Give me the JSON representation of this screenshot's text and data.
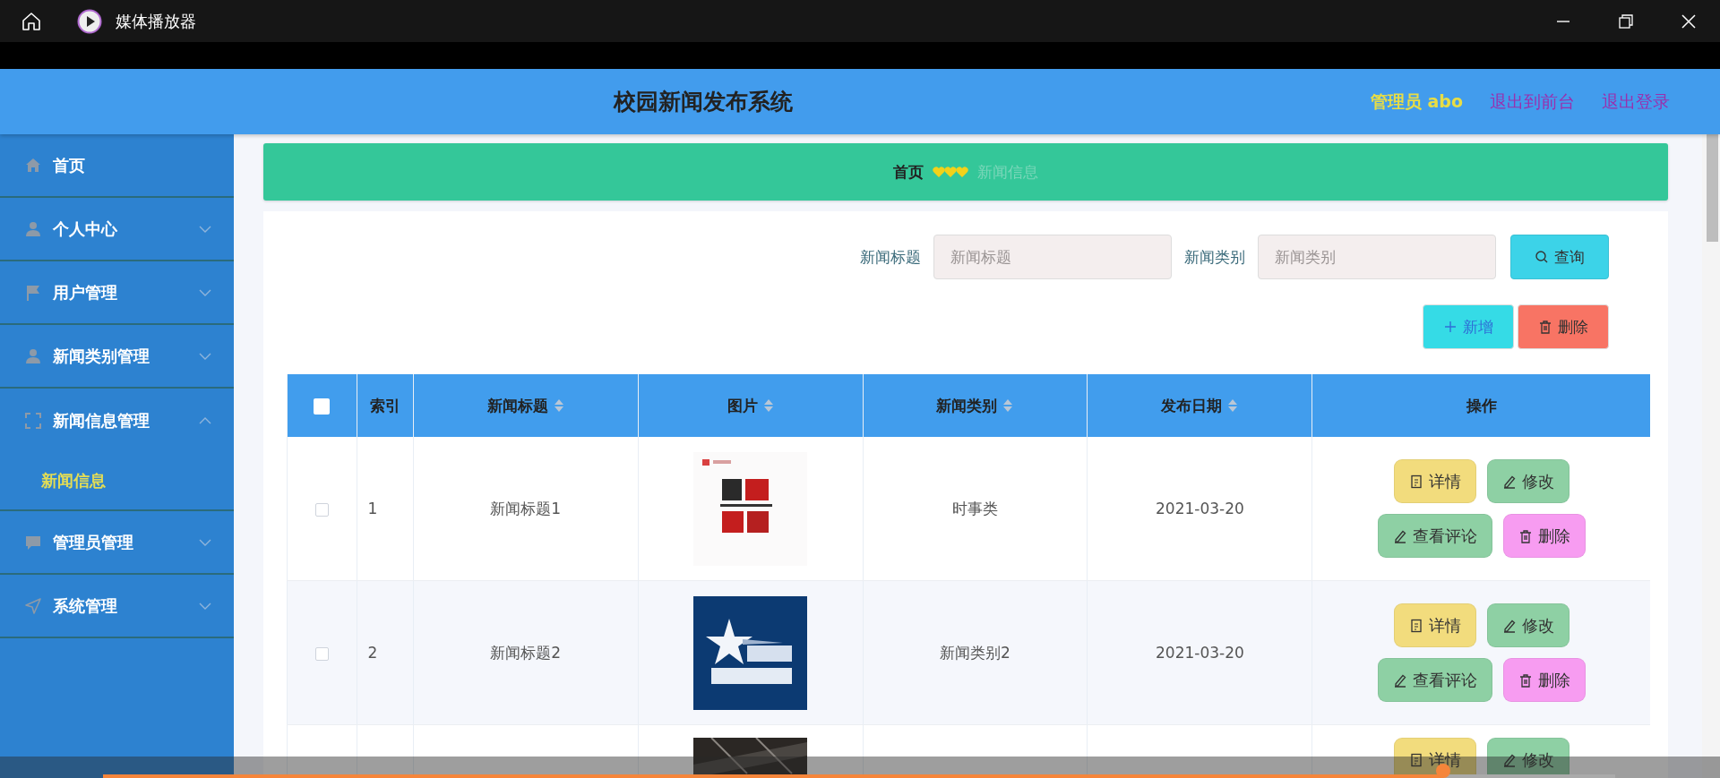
{
  "player": {
    "title": "媒体播放器",
    "progress": {
      "level": 0.886
    }
  },
  "header": {
    "title": "校园新闻发布系统",
    "user": "管理员 abo",
    "links": [
      "退出到前台",
      "退出登录"
    ]
  },
  "sidebar": {
    "items": [
      {
        "label": "首页"
      },
      {
        "label": "个人中心",
        "expanded": false
      },
      {
        "label": "用户管理",
        "expanded": false
      },
      {
        "label": "新闻类别管理",
        "expanded": false
      },
      {
        "label": "新闻信息管理",
        "expanded": true,
        "children": [
          {
            "label": "新闻信息",
            "selected": true
          }
        ]
      },
      {
        "label": "管理员管理",
        "expanded": false
      },
      {
        "label": "系统管理",
        "expanded": false
      }
    ]
  },
  "breadcrumb": [
    "首页",
    "新闻信息"
  ],
  "search": {
    "fields": [
      {
        "label": "新闻标题",
        "placeholder": "新闻标题"
      },
      {
        "label": "新闻类别",
        "placeholder": "新闻类别"
      }
    ],
    "button": "查询"
  },
  "toolbar": [
    {
      "label": "新增",
      "kind": "add"
    },
    {
      "label": "删除",
      "kind": "delete"
    }
  ],
  "table": {
    "columns": [
      {
        "kind": "checkbox",
        "checked": false
      },
      {
        "kind": "text",
        "label": "索引",
        "sortable": false
      },
      {
        "kind": "text",
        "label": "新闻标题",
        "sortable": true
      },
      {
        "kind": "text",
        "label": "图片",
        "sortable": true
      },
      {
        "kind": "text",
        "label": "新闻类别",
        "sortable": true
      },
      {
        "kind": "text",
        "label": "发布日期",
        "sortable": true
      },
      {
        "kind": "text",
        "label": "操作",
        "sortable": false
      }
    ],
    "rows": [
      {
        "checked": false,
        "index": "1",
        "title": "新闻标题1",
        "image": {
          "kind": "picture"
        },
        "category": "时事类",
        "date": "2021-03-20",
        "actions": [
          {
            "label": "详情",
            "kind": "detail"
          },
          {
            "label": "修改",
            "kind": "edit"
          },
          {
            "label": "查看评论",
            "kind": "comments"
          },
          {
            "label": "删除",
            "kind": "delete"
          }
        ]
      },
      {
        "checked": false,
        "index": "2",
        "title": "新闻标题2",
        "image": {
          "kind": "picture"
        },
        "category": "新闻类别2",
        "date": "2021-03-20",
        "actions": [
          {
            "label": "详情",
            "kind": "detail"
          },
          {
            "label": "修改",
            "kind": "edit"
          },
          {
            "label": "查看评论",
            "kind": "comments"
          },
          {
            "label": "删除",
            "kind": "delete"
          }
        ]
      },
      {
        "image": {
          "kind": "picture"
        },
        "actions": [
          {
            "label": "详情",
            "kind": "detail"
          },
          {
            "label": "修改",
            "kind": "edit"
          }
        ]
      }
    ]
  }
}
